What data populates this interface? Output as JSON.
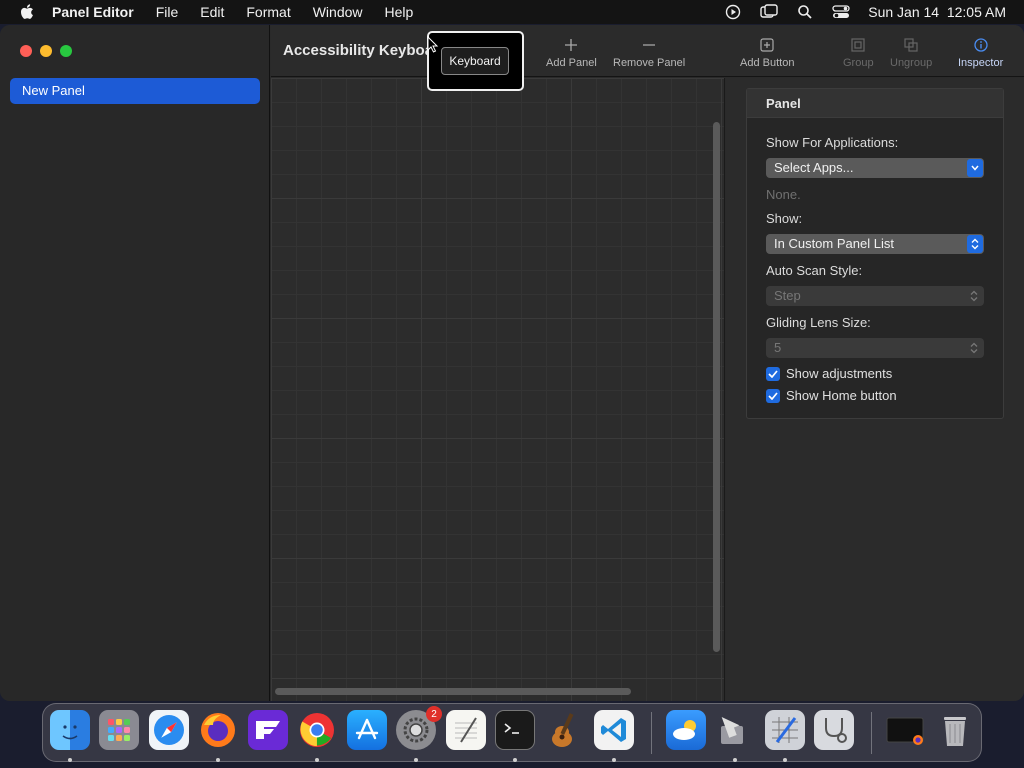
{
  "menubar": {
    "items": [
      "Panel Editor",
      "File",
      "Edit",
      "Format",
      "Window",
      "Help"
    ],
    "datetime": "Sun Jan 14  12:05 AM"
  },
  "sidebar": {
    "items": [
      {
        "label": "New Panel",
        "selected": true
      }
    ]
  },
  "toolbar": {
    "title": "Accessibility Keyboard",
    "add_panel": "Add Panel",
    "remove_panel": "Remove Panel",
    "add_button": "Add Button",
    "group": "Group",
    "ungroup": "Ungroup",
    "inspector": "Inspector"
  },
  "tooltip": {
    "text": "Keyboard"
  },
  "inspector": {
    "header": "Panel",
    "show_for_apps_label": "Show For Applications:",
    "select_apps_value": "Select Apps...",
    "apps_none": "None.",
    "show_label": "Show:",
    "show_value": "In Custom Panel List",
    "auto_scan_label": "Auto Scan Style:",
    "auto_scan_value": "Step",
    "lens_label": "Gliding Lens Size:",
    "lens_value": "5",
    "show_adjustments": "Show adjustments",
    "show_home": "Show Home button"
  },
  "dock": {
    "settings_badge": "2"
  },
  "colors": {
    "accent": "#1f6be0",
    "selection": "#1d5bd6"
  }
}
